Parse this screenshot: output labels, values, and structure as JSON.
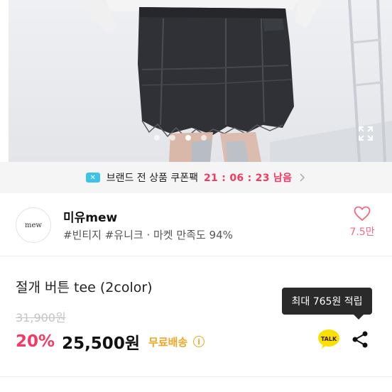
{
  "photo": {
    "slide_count": 4,
    "active_slide": 3
  },
  "coupon": {
    "icon": "coupon-icon",
    "text": "브랜드 전 상품 쿠폰팩",
    "timer": "21 : 06 : 23 남음",
    "chevron": "chevron-right-icon",
    "timer_color": "#f43a62"
  },
  "shop": {
    "avatar_text": "mew",
    "name": "미유mew",
    "tags": "#빈티지 #유니크 · 마켓 만족도 94%",
    "like_count": "7.5만",
    "like_icon": "heart-outline-icon"
  },
  "product": {
    "title": "절개 버튼 tee (2color)",
    "original_price": "31,900원",
    "discount": "20%",
    "price": "25,500원",
    "shipping": "무료배송",
    "shipping_info_icon": "info-icon",
    "tooltip": "최대 765원 적립",
    "talk_icon": "kakaotalk-icon",
    "talk_label": "TALK",
    "share_icon": "share-icon",
    "accent_color": "#f43a62",
    "shipping_color": "#f0a623"
  }
}
